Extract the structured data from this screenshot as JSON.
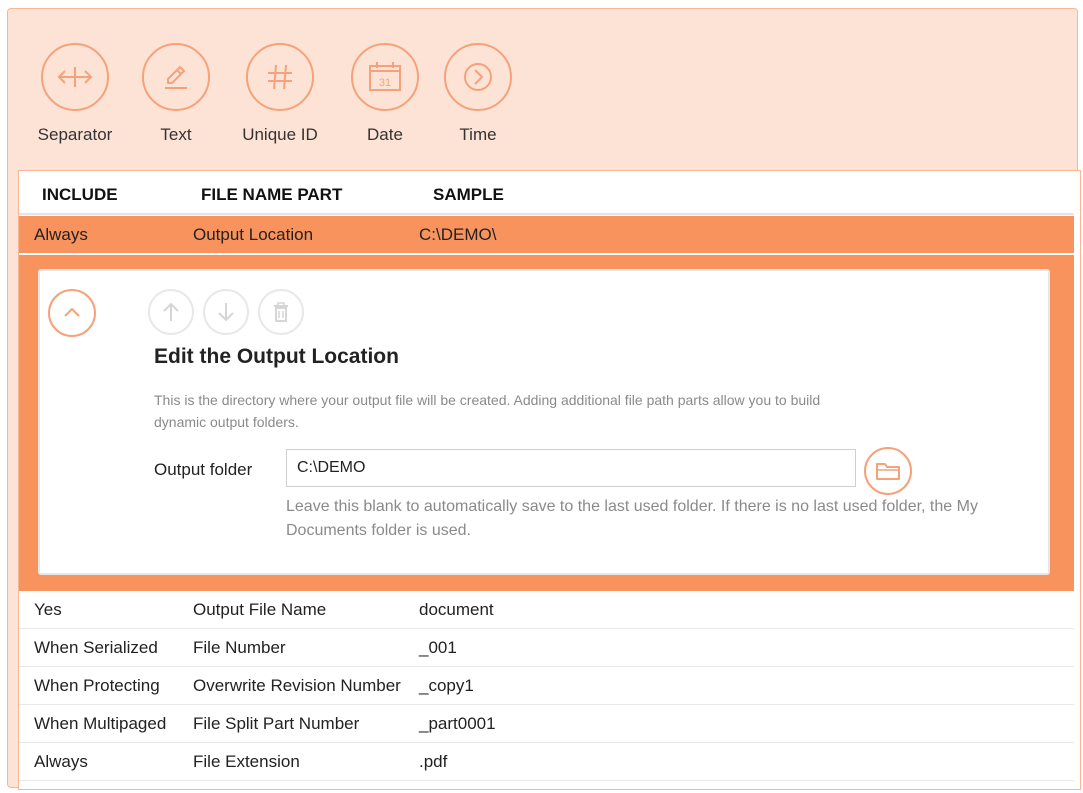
{
  "toolbar": {
    "items": [
      {
        "label": "Separator",
        "icon": "separator-arrows-icon"
      },
      {
        "label": "Text",
        "icon": "pencil-icon"
      },
      {
        "label": "Unique ID",
        "icon": "hash-icon"
      },
      {
        "label": "Date",
        "icon": "calendar-icon"
      },
      {
        "label": "Time",
        "icon": "chevron-right-circle-icon"
      }
    ]
  },
  "date_icon_text": "31",
  "table": {
    "columns": [
      "INCLUDE",
      "FILE NAME PART",
      "SAMPLE"
    ],
    "selected_row": {
      "include": "Always",
      "part": "Output Location",
      "sample": "C:\\DEMO\\"
    },
    "rows": [
      {
        "include": "Yes",
        "part": "Output File Name",
        "sample": "document"
      },
      {
        "include": "When Serialized",
        "part": "File Number",
        "sample": "_001"
      },
      {
        "include": "When Protecting",
        "part": "Overwrite Revision Number",
        "sample": "_copy1"
      },
      {
        "include": "When Multipaged",
        "part": "File Split Part Number",
        "sample": "_part0001"
      },
      {
        "include": "Always",
        "part": "File Extension",
        "sample": ".pdf"
      }
    ]
  },
  "editor": {
    "title": "Edit the Output Location",
    "description": "This is the directory where your output file will be created. Adding additional file path parts allow you to build dynamic output folders.",
    "field_label": "Output folder",
    "field_value": "C:\\DEMO",
    "field_help": "Leave this blank to automatically save to the last used folder. If there is no last used folder, the My Documents folder is used."
  },
  "colors": {
    "accent": "#f9935e",
    "accent_light": "#fde3d5",
    "icon_stroke": "#f5a27a",
    "disabled": "#d6d6d6"
  }
}
